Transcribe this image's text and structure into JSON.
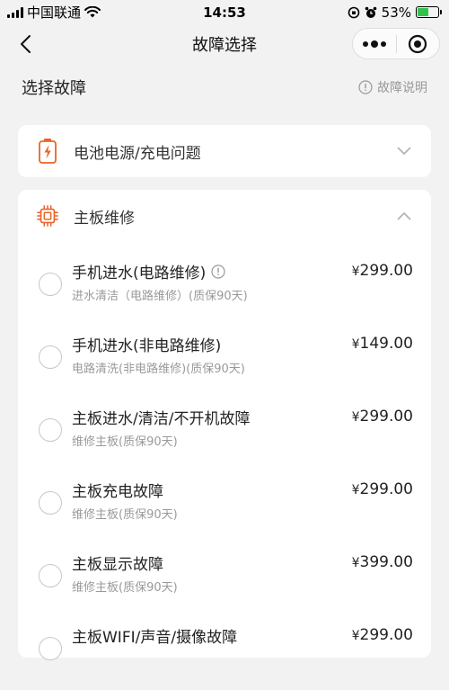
{
  "status": {
    "carrier": "中国联通",
    "time": "14:53",
    "battery_pct": "53%",
    "battery_level": 0.53
  },
  "nav": {
    "title": "故障选择"
  },
  "section": {
    "title": "选择故障",
    "help": "故障说明"
  },
  "categories": [
    {
      "label": "电池电源/充电问题",
      "expanded": false,
      "icon": "battery-icon"
    },
    {
      "label": "主板维修",
      "expanded": true,
      "icon": "chip-icon"
    }
  ],
  "items": [
    {
      "name": "手机进水(电路维修)",
      "sub": "进水清洁（电路维修）(质保90天)",
      "price": "299.00",
      "has_info": true
    },
    {
      "name": "手机进水(非电路维修)",
      "sub": "电路清洗(非电路维修)(质保90天)",
      "price": "149.00",
      "has_info": false
    },
    {
      "name": "主板进水/清洁/不开机故障",
      "sub": "维修主板(质保90天)",
      "price": "299.00",
      "has_info": false
    },
    {
      "name": "主板充电故障",
      "sub": "维修主板(质保90天)",
      "price": "299.00",
      "has_info": false
    },
    {
      "name": "主板显示故障",
      "sub": "维修主板(质保90天)",
      "price": "399.00",
      "has_info": false
    },
    {
      "name": "主板WIFI/声音/摄像故障",
      "sub": "",
      "price": "299.00",
      "has_info": false
    }
  ],
  "currency": "¥",
  "colors": {
    "accent": "#e8652a",
    "background": "#f2f2f2",
    "battery_green": "#2fc44b"
  }
}
